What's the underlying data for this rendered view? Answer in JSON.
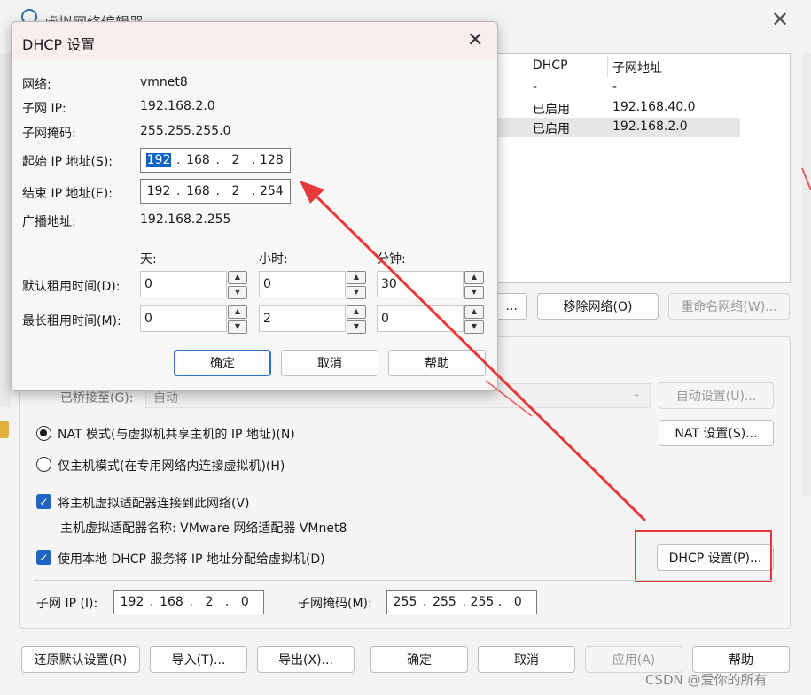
{
  "main_window": {
    "title": "虚拟网络编辑器",
    "table": {
      "headers": [
        "DHCP",
        "子网地址"
      ],
      "rows": [
        {
          "dhcp": "-",
          "subnet": "-"
        },
        {
          "dhcp": "已启用",
          "subnet": "192.168.40.0"
        },
        {
          "dhcp": "已启用",
          "subnet": "192.168.2.0"
        }
      ]
    },
    "buttons": {
      "add_network_partial": "...",
      "remove_network": "移除网络(O)",
      "rename_network": "重命名网络(W)...",
      "auto_settings": "自动设置(U)...",
      "nat_settings": "NAT 设置(S)...",
      "dhcp_settings": "DHCP 设置(P)...",
      "restore_defaults": "还原默认设置(R)",
      "import": "导入(T)...",
      "export": "导出(X)...",
      "ok": "确定",
      "cancel": "取消",
      "apply": "应用(A)",
      "help": "帮助"
    },
    "bridged_label": "已桥接至(G):",
    "bridged_value": "自动",
    "nat_mode_label": "NAT 模式(与虚拟机共享主机的 IP 地址)(N)",
    "host_only_label": "仅主机模式(在专用网络内连接虚拟机)(H)",
    "connect_adapter_label": "将主机虚拟适配器连接到此网络(V)",
    "adapter_name_label": "主机虚拟适配器名称: VMware 网络适配器 VMnet8",
    "use_dhcp_label": "使用本地 DHCP 服务将 IP 地址分配给虚拟机(D)",
    "subnet_ip_label": "子网 IP (I):",
    "subnet_ip": [
      "192",
      "168",
      "2",
      "0"
    ],
    "subnet_mask_label": "子网掩码(M):",
    "subnet_mask": [
      "255",
      "255",
      "255",
      "0"
    ],
    "watermark": "CSDN @爱你的所有"
  },
  "dhcp_dialog": {
    "title": "DHCP 设置",
    "network_label": "网络:",
    "network_value": "vmnet8",
    "subnet_ip_label": "子网 IP:",
    "subnet_ip_value": "192.168.2.0",
    "subnet_mask_label": "子网掩码:",
    "subnet_mask_value": "255.255.255.0",
    "start_ip_label": "起始 IP 地址(S):",
    "start_ip": [
      "192",
      "168",
      "2",
      "128"
    ],
    "end_ip_label": "结束 IP 地址(E):",
    "end_ip": [
      "192",
      "168",
      "2",
      "254"
    ],
    "broadcast_label": "广播地址:",
    "broadcast_value": "192.168.2.255",
    "col_days": "天:",
    "col_hours": "小时:",
    "col_minutes": "分钟:",
    "default_lease_label": "默认租用时间(D):",
    "default_lease": {
      "days": "0",
      "hours": "0",
      "minutes": "30"
    },
    "max_lease_label": "最长租用时间(M):",
    "max_lease": {
      "days": "0",
      "hours": "2",
      "minutes": "0"
    },
    "ok": "确定",
    "cancel": "取消",
    "help": "帮助"
  },
  "colors": {
    "annotation_red": "#e8393a",
    "selection_blue": "#0a64c8",
    "checkbox_blue": "#1f63c4"
  }
}
